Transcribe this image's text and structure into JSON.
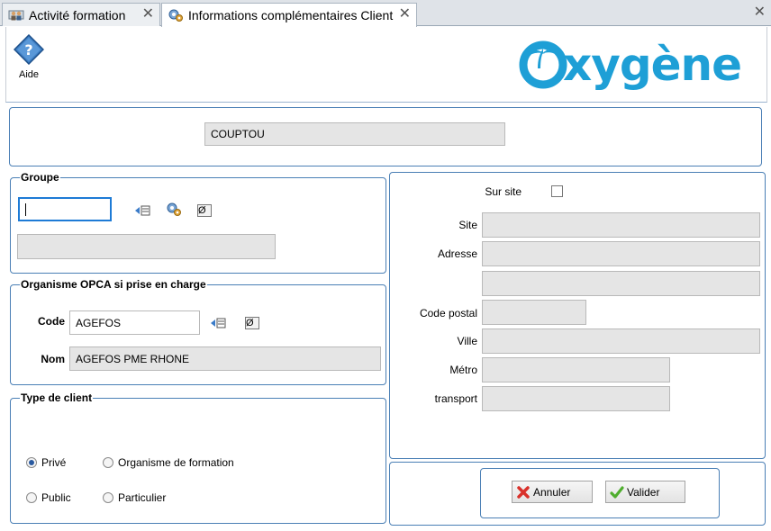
{
  "tabs": [
    {
      "label": "Activité formation",
      "active": false
    },
    {
      "label": "Informations complémentaires Client",
      "active": true
    }
  ],
  "toolbar": {
    "help_label": "Aide"
  },
  "logo": {
    "text": "oxygène",
    "color": "#1e9fd6"
  },
  "client": {
    "name": "COUPTOU"
  },
  "groupe": {
    "legend": "Groupe",
    "code_value": "",
    "name_value": ""
  },
  "opca": {
    "legend": "Organisme OPCA si prise en charge",
    "code_label": "Code",
    "code_value": "AGEFOS",
    "nom_label": "Nom",
    "nom_value": "AGEFOS PME RHONE"
  },
  "type_client": {
    "legend": "Type de client",
    "options": [
      {
        "label": "Privé",
        "checked": true
      },
      {
        "label": "Organisme de formation",
        "checked": false
      },
      {
        "label": "Public",
        "checked": false
      },
      {
        "label": "Particulier",
        "checked": false
      }
    ]
  },
  "site": {
    "sur_site_label": "Sur site",
    "sur_site_checked": false,
    "site_label": "Site",
    "adresse_label": "Adresse",
    "code_postal_label": "Code postal",
    "ville_label": "Ville",
    "metro_label": "Métro",
    "transport_label": "transport"
  },
  "actions": {
    "cancel_label": "Annuler",
    "validate_label": "Valider"
  },
  "colors": {
    "accent": "#4a7fb5",
    "logo": "#1e9fd6",
    "cancel": "#d9312b",
    "validate": "#4fae2e"
  }
}
